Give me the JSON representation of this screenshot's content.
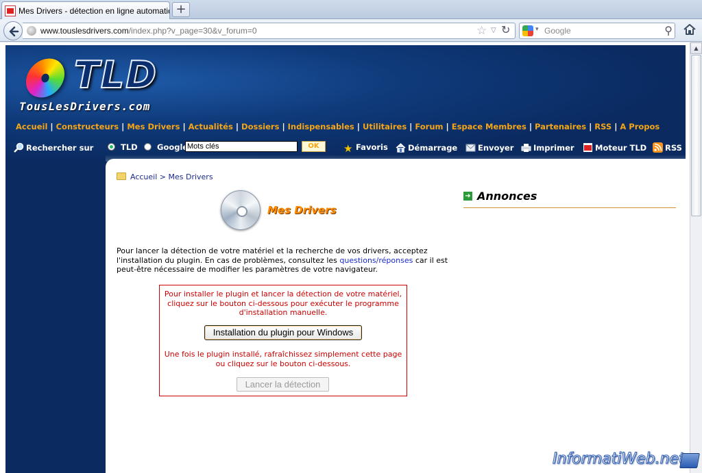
{
  "browser": {
    "tab_title": "Mes Drivers - détection en ligne automatique...",
    "new_tab_label": "+",
    "url_host": "www.touslesdrivers.com",
    "url_rest": "/index.php?v_page=30&v_forum=0",
    "search_placeholder": "Google"
  },
  "header": {
    "logo_tld": "TLD",
    "logo_site": "TousLesDrivers.com"
  },
  "menu": {
    "items": [
      "Accueil",
      "Constructeurs",
      "Mes Drivers",
      "Actualités",
      "Dossiers",
      "Indispensables",
      "Utilitaires",
      "Forum",
      "Espace Membres",
      "Partenaires",
      "RSS",
      "A Propos"
    ]
  },
  "toolbar": {
    "search_label": "Rechercher sur",
    "opt_tld": "TLD",
    "opt_google": "Google",
    "keyword_value": "Mots clés",
    "ok_label": "OK",
    "favoris": "Favoris",
    "demarrage": "Démarrage",
    "envoyer": "Envoyer",
    "imprimer": "Imprimer",
    "moteur": "Moteur TLD",
    "rss": "RSS"
  },
  "breadcrumb": {
    "home": "Accueil",
    "separator": " > ",
    "current": "Mes Drivers"
  },
  "main": {
    "section_title": "Mes Drivers",
    "intro_before": "Pour lancer la détection de votre matériel et la recherche de vos drivers, acceptez l'installation du plugin. En cas de problèmes, consultez les ",
    "intro_link": "questions/réponses",
    "intro_after": " car il est peut-être nécessaire de modifier les paramètres de votre navigateur.",
    "box_text_top": "Pour installer le plugin et lancer la détection de votre matériel, cliquez sur le bouton ci-dessous pour exécuter le programme d'installation manuelle.",
    "install_button": "Installation du plugin pour Windows",
    "box_text_bottom": "Une fois le plugin installé, rafraîchissez simplement cette page ou cliquez sur le bouton ci-dessous.",
    "launch_button": "Lancer la détection"
  },
  "sidebar": {
    "title": "Annonces"
  },
  "watermark": "InformatiWeb.net"
}
